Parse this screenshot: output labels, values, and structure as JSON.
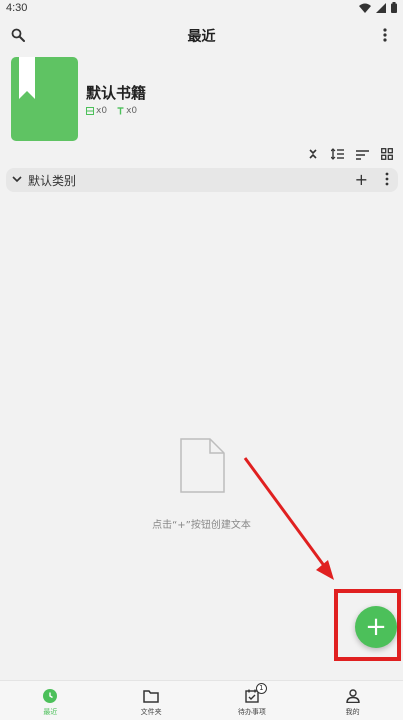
{
  "status_bar": {
    "time": "4:30"
  },
  "header": {
    "title": "最近"
  },
  "book": {
    "title": "默认书籍",
    "folders_count": "x0",
    "texts_count": "x0"
  },
  "category": {
    "label": "默认类别",
    "add_label": "+"
  },
  "empty_state": {
    "message": "点击“+”按钮创建文本"
  },
  "fab": {
    "label": "+"
  },
  "bottom_nav": {
    "items": [
      {
        "label": "最近",
        "active": true
      },
      {
        "label": "文件夹",
        "active": false
      },
      {
        "label": "待办事项",
        "active": false,
        "badge": "1"
      },
      {
        "label": "我的",
        "active": false
      }
    ]
  },
  "colors": {
    "accent": "#4cc05a",
    "cover": "#5fc363",
    "highlight": "#e02020"
  },
  "icons": [
    "search-icon",
    "more-vert-icon",
    "bookmark-icon",
    "collapse-icon",
    "sort-order-icon",
    "sort-icon",
    "grid-view-icon",
    "chevron-down-icon",
    "empty-file-icon",
    "clock-icon",
    "folder-icon",
    "todo-icon",
    "person-icon"
  ]
}
